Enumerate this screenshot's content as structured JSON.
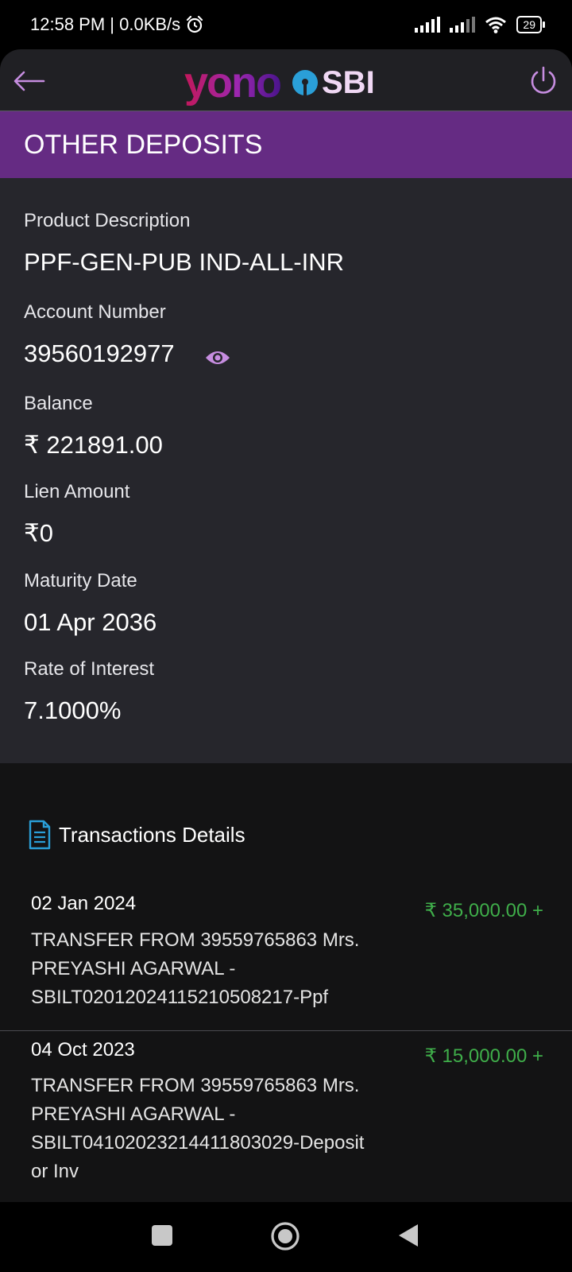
{
  "status_bar": {
    "time_network": "12:58 PM | 0.0KB/s",
    "battery": "29",
    "icons": [
      "alarm-icon",
      "signal-icon",
      "signal-icon",
      "wifi-icon",
      "battery-icon"
    ]
  },
  "header": {
    "logo_yono": "yono",
    "logo_sbi": "SBI",
    "back_icon": "back-arrow-icon",
    "power_icon": "power-icon"
  },
  "section": {
    "title": "OTHER DEPOSITS"
  },
  "details": {
    "product_label": "Product Description",
    "product_value": "PPF-GEN-PUB IND-ALL-INR",
    "account_label": "Account Number",
    "account_value": "39560192977",
    "balance_label": "Balance",
    "balance_value": "₹ 221891.00",
    "lien_label": "Lien Amount",
    "lien_value": "₹0",
    "maturity_label": "Maturity Date",
    "maturity_value": "01 Apr 2036",
    "interest_label": "Rate of Interest",
    "interest_value": "7.1000%"
  },
  "transactions": {
    "title": "Transactions Details",
    "items": [
      {
        "date": "02 Jan 2024",
        "description": "TRANSFER FROM 39559765863 Mrs. PREYASHI AGARWAL - SBILT02012024115210508217-Ppf",
        "amount": "₹ 35,000.00  +"
      },
      {
        "date": "04 Oct 2023",
        "description": "TRANSFER FROM 39559765863 Mrs. PREYASHI AGARWAL - SBILT04102023214411803029-Deposit or Inv",
        "amount": "₹ 15,000.00  +"
      }
    ]
  },
  "colors": {
    "section_bar": "#652b83",
    "credit_amount": "#3fae4a",
    "accent_icon": "#c68de0"
  }
}
